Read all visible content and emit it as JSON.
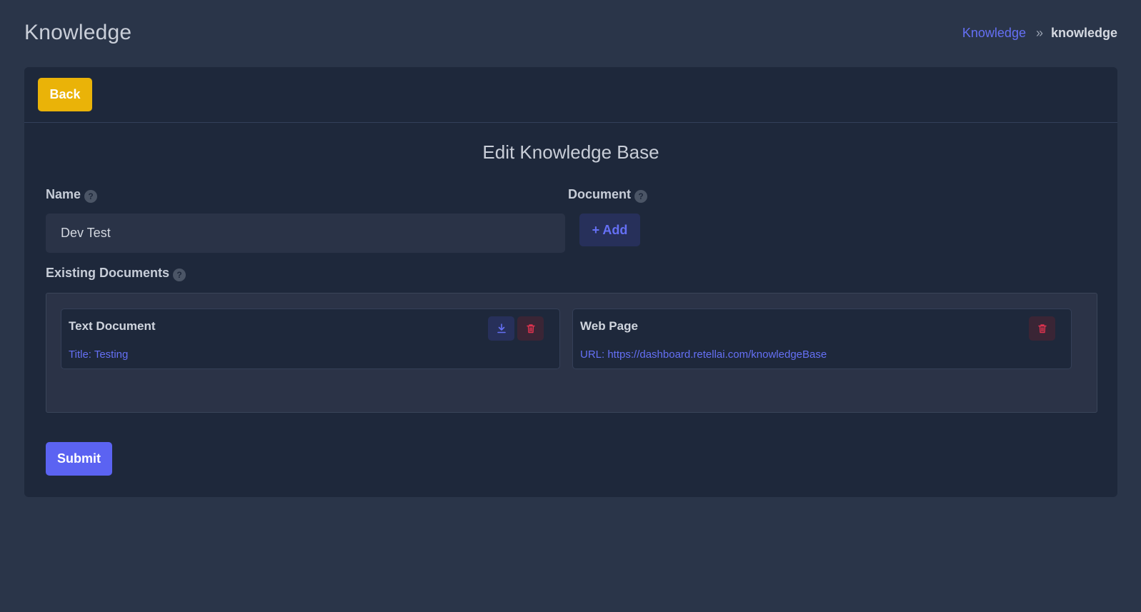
{
  "header": {
    "title": "Knowledge",
    "breadcrumb": {
      "link": "Knowledge",
      "separator": "»",
      "current": "knowledge"
    }
  },
  "toolbar": {
    "back_label": "Back"
  },
  "form": {
    "title": "Edit Knowledge Base",
    "name_label": "Name",
    "name_value": "Dev Test",
    "document_label": "Document",
    "add_label": "+ Add",
    "existing_label": "Existing Documents",
    "help_glyph": "?",
    "submit_label": "Submit"
  },
  "documents": [
    {
      "type": "Text Document",
      "detail": "Title: Testing",
      "actions": [
        "download-icon",
        "trash-icon"
      ]
    },
    {
      "type": "Web Page",
      "detail": "URL: https://dashboard.retellai.com/knowledgeBase",
      "actions": [
        "trash-icon"
      ]
    }
  ],
  "colors": {
    "background": "#2a3549",
    "card": "#1e283b",
    "accent": "#6570f5",
    "back_button": "#eab308",
    "submit_button": "#5b63f2",
    "danger": "#e0334f"
  }
}
